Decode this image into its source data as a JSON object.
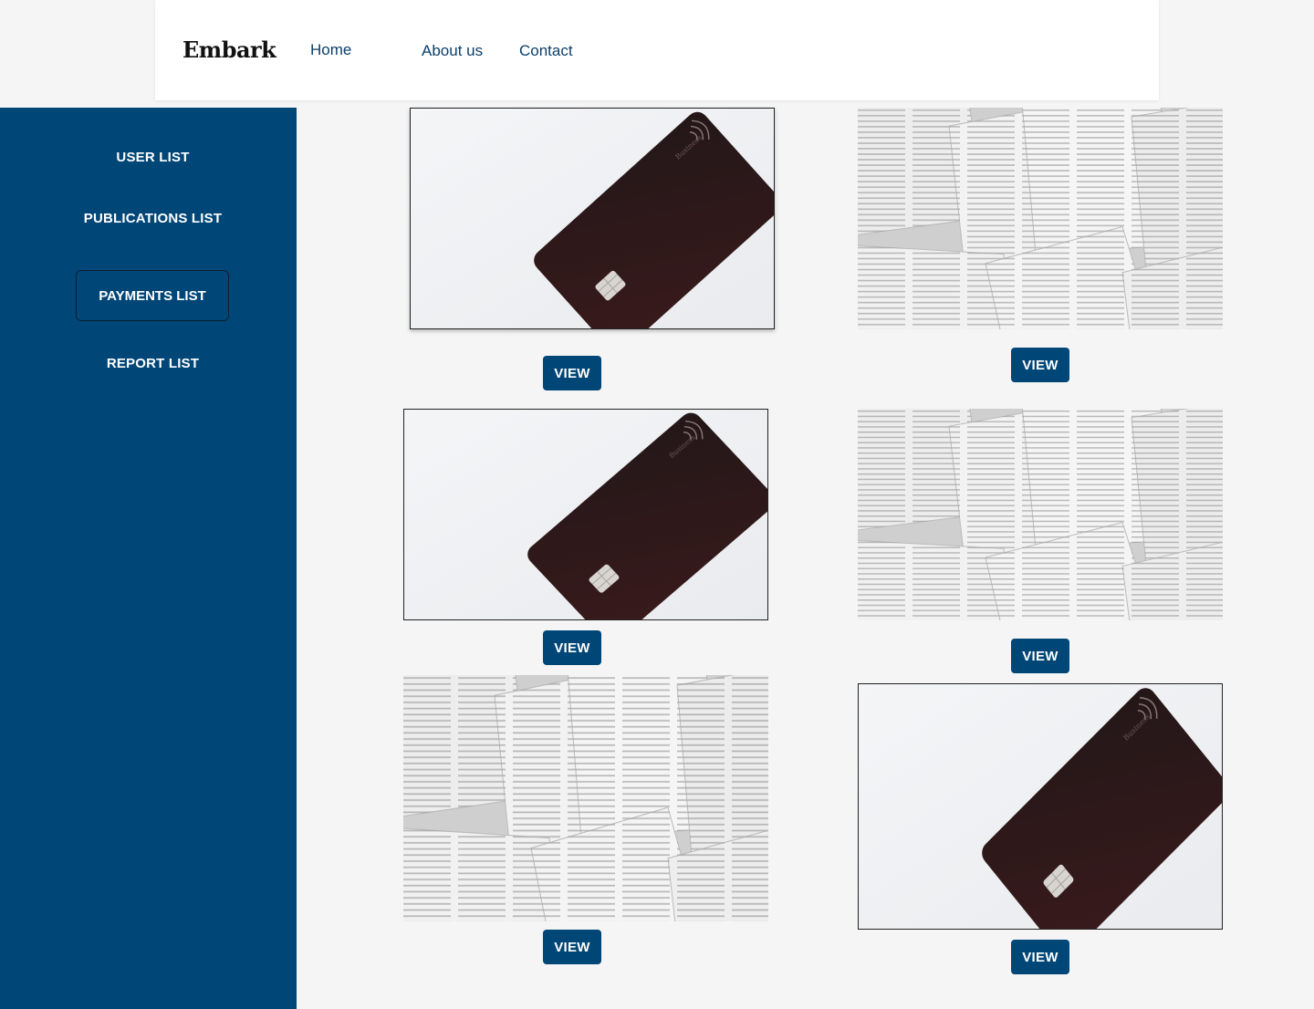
{
  "header": {
    "logo": "Embark",
    "nav": [
      {
        "label": "Home"
      },
      {
        "label": "About us"
      },
      {
        "label": "Contact"
      }
    ]
  },
  "sidebar": {
    "items": [
      {
        "label": "USER LIST"
      },
      {
        "label": "PUBLICATIONS LIST"
      },
      {
        "label": "PAYMENTS LIST",
        "active": true
      },
      {
        "label": "REPORT LIST"
      }
    ]
  },
  "grid": {
    "cards": [
      {
        "image": "credit-card-photo",
        "button": "VIEW"
      },
      {
        "image": "open-books-photo",
        "button": "VIEW"
      },
      {
        "image": "credit-card-photo",
        "button": "VIEW"
      },
      {
        "image": "open-books-photo",
        "button": "VIEW"
      },
      {
        "image": "open-books-photo",
        "button": "VIEW"
      },
      {
        "image": "credit-card-photo",
        "button": "VIEW"
      }
    ]
  },
  "colors": {
    "primary": "#004677",
    "nav_text": "#0b3f6b",
    "background": "#f5f5f5"
  }
}
